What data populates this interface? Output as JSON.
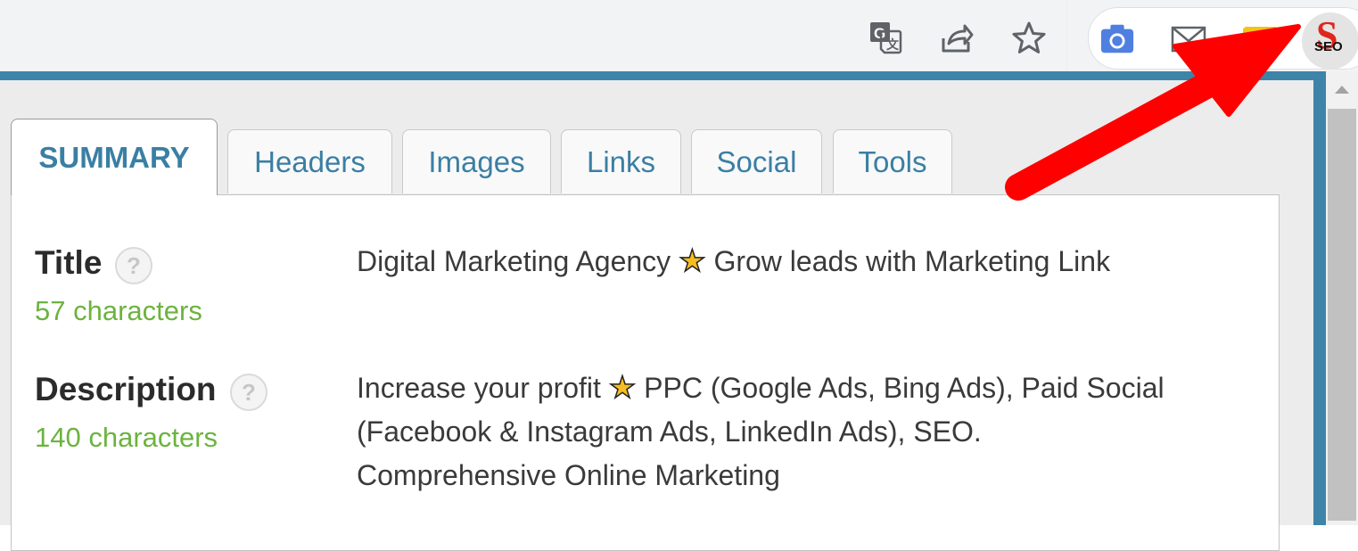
{
  "toolbar": {
    "icons": [
      "translate-icon",
      "share-icon",
      "bookmark-star-icon"
    ],
    "extensions": [
      "camera-icon",
      "mail-icon",
      "yellow-extension-icon",
      "seo-extension-icon"
    ],
    "seo_badge": {
      "letter": "S",
      "text": "SEO"
    }
  },
  "tabs": [
    {
      "label": "SUMMARY",
      "active": true
    },
    {
      "label": "Headers"
    },
    {
      "label": "Images"
    },
    {
      "label": "Links"
    },
    {
      "label": "Social"
    },
    {
      "label": "Tools"
    }
  ],
  "summary": {
    "title": {
      "label": "Title",
      "help": "?",
      "count": "57 characters",
      "value_before": "Digital Marketing Agency",
      "star": "★",
      "value_after": "Grow leads with Marketing Link"
    },
    "description": {
      "label": "Description",
      "help": "?",
      "count": "140 characters",
      "line1_before": "Increase your profit",
      "star": "★",
      "line1_after": "PPC (Google Ads, Bing Ads), Paid Social",
      "line2": "(Facebook & Instagram Ads, LinkedIn Ads), SEO.",
      "line3": "Comprehensive Online Marketing"
    }
  },
  "colors": {
    "accent": "#3a7fa4",
    "frame": "#3d84a8",
    "count_green": "#6cb33f",
    "arrow_red": "#ff0000"
  }
}
